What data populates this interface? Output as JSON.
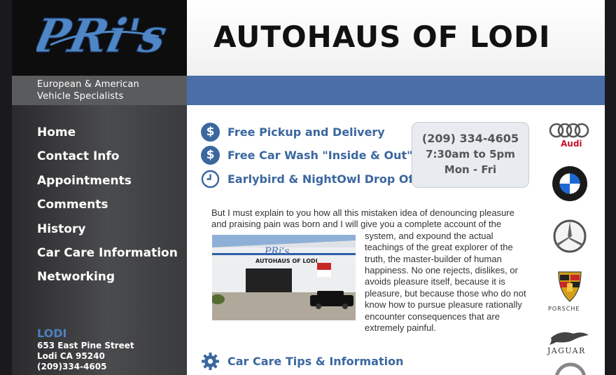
{
  "sidebar": {
    "logo_text": "PRi's",
    "tagline": [
      "European & American",
      "Vehicle Specialists"
    ],
    "nav": [
      "Home",
      "Contact Info",
      "Appointments",
      "Comments",
      "History",
      "Car Care Information",
      "Networking"
    ],
    "location": {
      "city": "LODI",
      "address": "653 East Pine Street",
      "citystate": "Lodi CA 95240",
      "phone": "(209)334-4605"
    }
  },
  "header": {
    "title": "AUTOHAUS OF LODI"
  },
  "features": [
    {
      "icon": "dollar-icon",
      "label": "Free Pickup and Delivery"
    },
    {
      "icon": "dollar-icon",
      "label": "Free Car Wash \"Inside & Out\""
    },
    {
      "icon": "clock-icon",
      "label": "Earlybird & NightOwl Drop Off"
    }
  ],
  "hours": {
    "phone": "(209) 334-4605",
    "time": "7:30am to 5pm",
    "days": "Mon - Fri"
  },
  "content": {
    "para_top": "But I must explain to you how all this mistaken idea of denouncing pleasure and praising pain was born and I will give you a complete account of the",
    "para_body": "system, and expound the actual teachings of the great explorer of the truth, the master-builder of human happiness. No one rejects, dislikes, or avoids pleasure itself, because it is pleasure, but because those who do not know how to pursue pleasure rationally encounter consequences that are extremely painful.",
    "photo_sign": "AUTOHAUS OF LODI",
    "photo_logo": "PRi's"
  },
  "tips": {
    "icon": "gear-icon",
    "label": "Car Care Tips & Information"
  },
  "brands": [
    {
      "name": "Audi",
      "label": "Audi"
    },
    {
      "name": "BMW",
      "label": "BMW"
    },
    {
      "name": "Mercedes-Benz",
      "label": ""
    },
    {
      "name": "Porsche",
      "label": "PORSCHE"
    },
    {
      "name": "Jaguar",
      "label": "JAGUAR"
    }
  ]
}
